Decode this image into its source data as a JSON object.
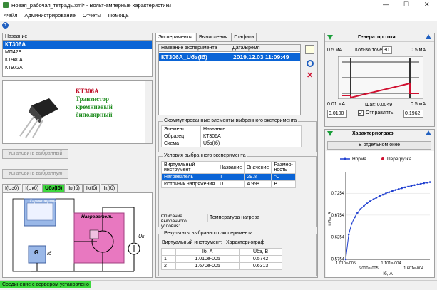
{
  "window": {
    "title": "Новая_рабочая_тетрадь.xml* - Вольт-амперные характеристики",
    "min": "—",
    "max": "☐",
    "close": "✕"
  },
  "menu": [
    "Файл",
    "Администрирование",
    "Отчеты",
    "Помощь"
  ],
  "toolbar": {
    "help_icon": "?"
  },
  "components": {
    "header": "Название",
    "items": [
      "КТ306А",
      "МП42Б",
      "КТ940А",
      "КТ972А"
    ]
  },
  "component_info": {
    "name": "КТ306А",
    "type": "Транзистор",
    "material": "кремниевый",
    "kind": "биполярный"
  },
  "buttons": {
    "install_selected": "Установить выбранный",
    "install_selected2": "Установить выбранную",
    "in_window": "В отдельном окне"
  },
  "scheme_tabs": [
    "I(Uэб)",
    "I(Uкб)",
    "Uбэ(Iб)",
    "Iк(Iб)",
    "Iк(Iб)",
    "Iк(Iб)"
  ],
  "scheme": {
    "graph_label": "Характериограф",
    "heater_label": "Нагреватель",
    "g": "G",
    "ib": "Iб",
    "uk": "Uк"
  },
  "main_tabs": [
    "Эксперименты",
    "Вычисления",
    "Графики"
  ],
  "experiments": {
    "col_name": "Название эксперимента",
    "col_date": "Дата/Время",
    "rows": [
      {
        "name": "КТ306А_Uбэ(Iб)",
        "date": "2019.12.03 11:09:49"
      }
    ]
  },
  "connected": {
    "title": "Скоммутированные элементы выбранного эксперимента",
    "col_el": "Элемент",
    "col_name": "Название",
    "rows": [
      [
        "Образец",
        "КТ306А"
      ],
      [
        "Схема",
        "Uбэ(Iб)"
      ]
    ]
  },
  "conditions": {
    "title": "Условия выбранного эксперимента",
    "cols": [
      "Виртуальный инструмент",
      "Название",
      "Значение",
      "Размер-ность"
    ],
    "rows": [
      [
        "Нагреватель",
        "T",
        "29.8",
        "°C"
      ],
      [
        "Источник напряжения",
        "U",
        "4.998",
        "В"
      ]
    ],
    "desc_label": "Описание выбранного условия:",
    "desc_value": "Температура нагрева"
  },
  "results": {
    "title": "Результаты выбранного эксперимента",
    "instr_label": "Виртуальный инструмент:",
    "instr_value": "Характериограф",
    "cols": [
      "Iб, А",
      "Uбэ, В"
    ],
    "rows": [
      [
        "1",
        "1.010e-005",
        "0.5742"
      ],
      [
        "2",
        "1.670e-005",
        "0.6313"
      ]
    ]
  },
  "generator": {
    "title": "Генератор тока",
    "left_top": "0.5 мА",
    "right_top": "0.5 мА",
    "points_label": "Кол-во точек:",
    "points_value": "30",
    "left_bottom": "0.01 мА",
    "right_bottom": "0.5 мА",
    "step_label": "Шаг: 0.0049",
    "send_label": "Отправлять",
    "left_value": "0.0100",
    "right_value": "0.1962"
  },
  "characteriograph": {
    "title": "Характериограф"
  },
  "colors": {
    "accent": "#0a64d6",
    "green": "#1a9e3a",
    "pink": "#e878c0",
    "chart_line": "#1f3fd0",
    "overload": "#d01030"
  },
  "status": "Соединение с сервером установлено",
  "chart_data": {
    "type": "scatter",
    "legend": [
      "Норма",
      "Перегрузка"
    ],
    "ylabel": "Uбэ, В",
    "xlabel": "Iб, А",
    "xticks_top": [
      "1.010e-005",
      "1.101e-004"
    ],
    "xticks_bottom": [
      "6.010e-005",
      "1.601e-004"
    ],
    "yticks": [
      "0.5754",
      "0.6254",
      "0.6754",
      "0.7254"
    ],
    "ylim": [
      0.5742,
      0.76
    ],
    "xlim": [
      1.01e-05,
      0.000196
    ],
    "x": [
      1.01e-05,
      1.67e-05,
      2.3e-05,
      2.95e-05,
      3.6e-05,
      4.3e-05,
      5e-05,
      5.7e-05,
      6.4e-05,
      7.1e-05,
      7.8e-05,
      8.5e-05,
      9.2e-05,
      9.9e-05,
      0.000106,
      0.000113,
      0.00012,
      0.000127,
      0.000134,
      0.000141,
      0.000148,
      0.000155,
      0.000162,
      0.000169,
      0.000176,
      0.000183,
      0.00019,
      0.0001962
    ],
    "y": [
      0.5742,
      0.6313,
      0.6552,
      0.6701,
      0.6808,
      0.6892,
      0.6961,
      0.702,
      0.7071,
      0.7115,
      0.7155,
      0.7191,
      0.7223,
      0.7253,
      0.728,
      0.7305,
      0.7329,
      0.735,
      0.7371,
      0.739,
      0.7408,
      0.7425,
      0.7441,
      0.7456,
      0.7471,
      0.7485,
      0.7498,
      0.751
    ]
  }
}
